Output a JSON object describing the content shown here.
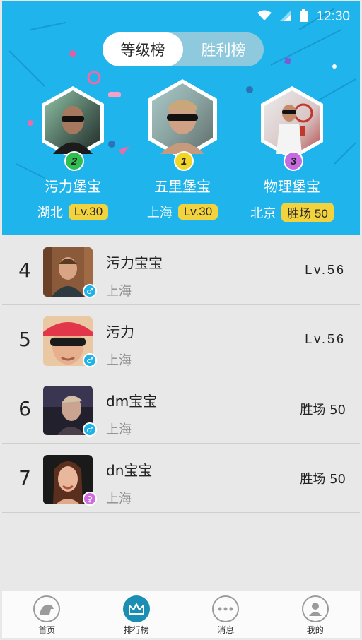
{
  "status": {
    "time": "12:30"
  },
  "tabs": [
    {
      "label": "等级榜",
      "active": true
    },
    {
      "label": "胜利榜",
      "active": false
    }
  ],
  "podium": [
    {
      "rank": "2",
      "name": "污力堡宝",
      "city": "湖北",
      "score": "Lv.30",
      "rank_color": "#2fbe4f"
    },
    {
      "rank": "1",
      "name": "五里堡宝",
      "city": "上海",
      "score": "Lv.30",
      "rank_color": "#f3d52a"
    },
    {
      "rank": "3",
      "name": "物理堡宝",
      "city": "北京",
      "score": "胜场 50",
      "rank_color": "#c56ae0"
    }
  ],
  "list": [
    {
      "rank": "4",
      "name": "污力宝宝",
      "city": "上海",
      "score": "Lv.56",
      "gender": "♂",
      "gender_color": "#1db3e8"
    },
    {
      "rank": "5",
      "name": "污力",
      "city": "上海",
      "score": "Lv.56",
      "gender": "♂",
      "gender_color": "#1db3e8"
    },
    {
      "rank": "6",
      "name": "dm宝宝",
      "city": "上海",
      "score": "胜场 50",
      "gender": "♂",
      "gender_color": "#1db3e8"
    },
    {
      "rank": "7",
      "name": "dn宝宝",
      "city": "上海",
      "score": "胜场 50",
      "gender": "♀",
      "gender_color": "#d06be0"
    }
  ],
  "nav": [
    {
      "label": "首页",
      "icon": "home-icon",
      "active": false
    },
    {
      "label": "排行榜",
      "icon": "crown-icon",
      "active": true
    },
    {
      "label": "消息",
      "icon": "message-icon",
      "active": false
    },
    {
      "label": "我的",
      "icon": "profile-icon",
      "active": false
    }
  ],
  "colors": {
    "accent": "#1fb4ec",
    "badge": "#f2d33e",
    "nav_active": "#1a8fb3"
  }
}
